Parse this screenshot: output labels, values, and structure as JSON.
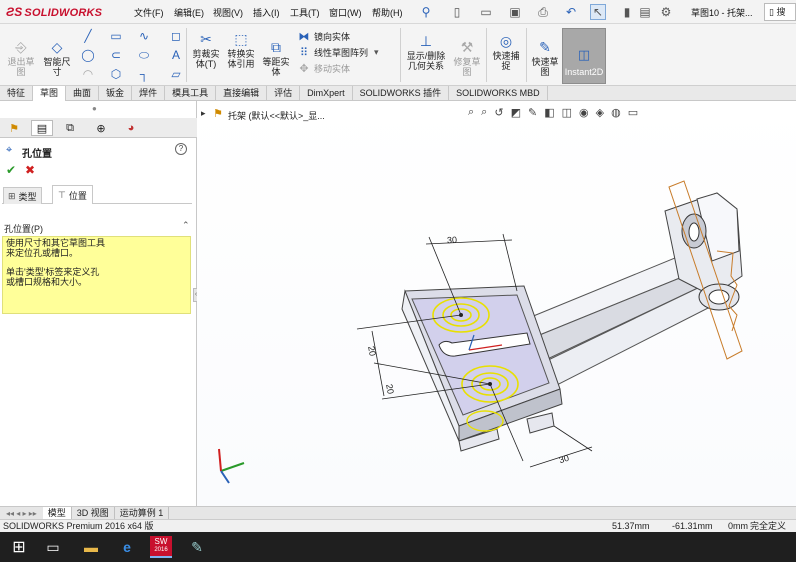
{
  "app": {
    "logo": "SOLIDWORKS",
    "doc_title": "草图10 - 托架...",
    "search_label": "搜"
  },
  "menu": [
    "文件(F)",
    "编辑(E)",
    "视图(V)",
    "插入(I)",
    "工具(T)",
    "窗口(W)",
    "帮助(H)"
  ],
  "ribbon": {
    "exit_sketch": "退出草\n图",
    "smart_dim": "智能尺\n寸",
    "trim": "剪裁实\n体(T)",
    "convert": "转换实\n体引用",
    "offset": "等距实\n体",
    "mirror": "镜向实体",
    "linear_pattern": "线性草图阵列",
    "move": "移动实体",
    "show_relations": "显示/删除\n几何关系",
    "repair": "修复草\n图",
    "quick_snap": "快速捕\n捉",
    "rapid_sketch": "快速草\n图",
    "instant2d": "Instant2D"
  },
  "tabs": [
    "特征",
    "草图",
    "曲面",
    "钣金",
    "焊件",
    "模具工具",
    "直接编辑",
    "评估",
    "DimXpert",
    "SOLIDWORKS 插件",
    "SOLIDWORKS MBD"
  ],
  "active_tab": "草图",
  "panel": {
    "title": "孔位置",
    "subtab_type": "类型",
    "subtab_position": "位置",
    "section_title": "孔位置(P)",
    "info_line1": "使用尺寸和其它草图工具",
    "info_line2": "来定位孔或槽口。",
    "info_line3": "单击'类型'标签来定义孔",
    "info_line4": "或槽口规格和大小。"
  },
  "tree": {
    "label": "托架 (默认<<默认>_显..."
  },
  "dims": {
    "top": "30",
    "left1": "20",
    "left2": "20",
    "bottom": "30"
  },
  "bottom_tabs": [
    "模型",
    "3D 视图",
    "运动算例 1"
  ],
  "status": {
    "product": "SOLIDWORKS Premium 2016 x64 版",
    "x": "51.37mm",
    "y": "-61.31mm",
    "z": "0mm",
    "state": "完全定义"
  },
  "taskbar": {
    "sw_badge": "2016"
  },
  "colors": {
    "accent": "#2a62b8",
    "brand": "#c8102e",
    "info_bg": "#ffff99",
    "highlight": "#e8e000"
  }
}
